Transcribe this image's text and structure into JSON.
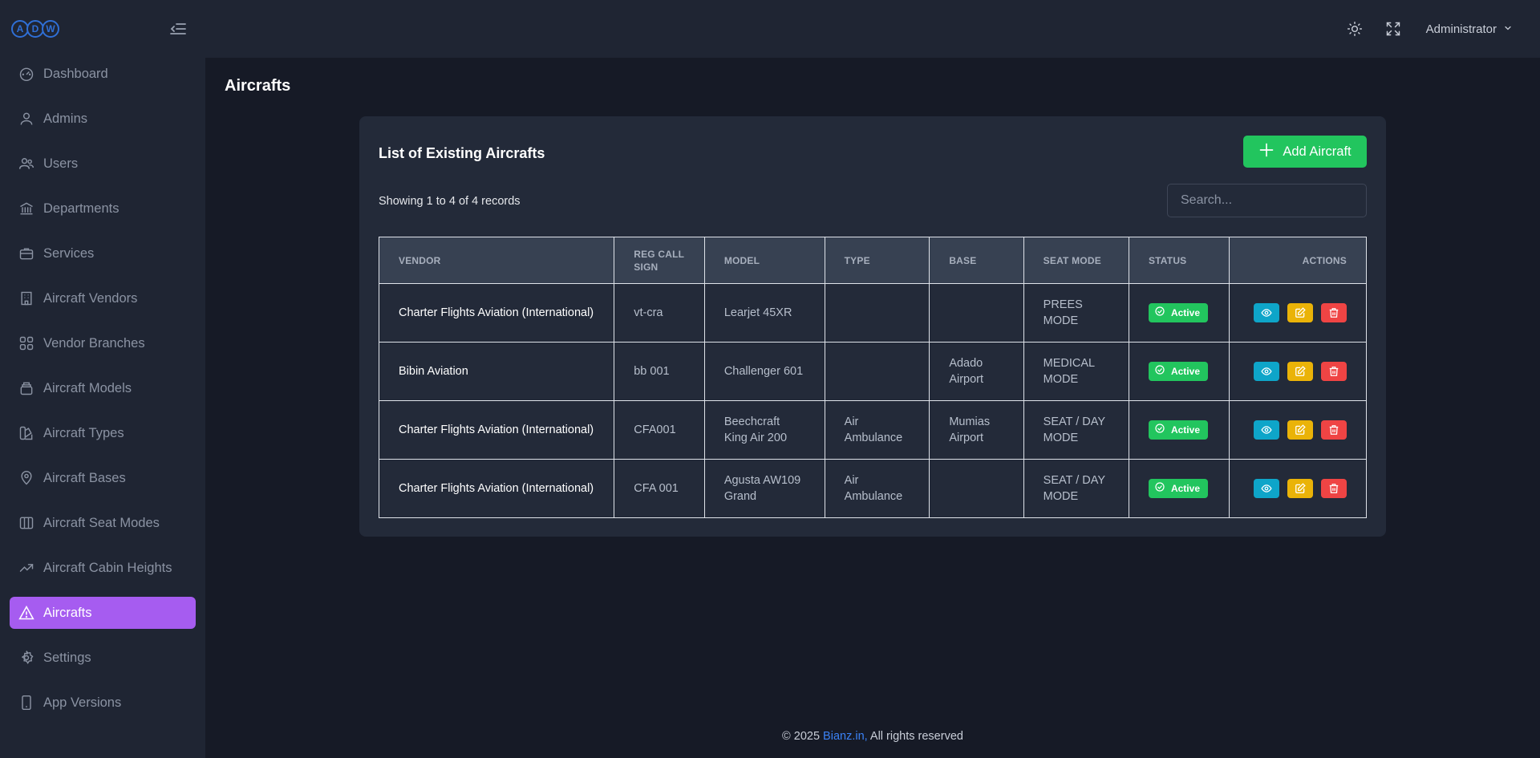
{
  "app": {
    "logo_letters": [
      "A",
      "D",
      "W"
    ]
  },
  "sidebar": {
    "items": [
      {
        "label": "Dashboard",
        "icon": "dashboard-icon"
      },
      {
        "label": "Admins",
        "icon": "user-icon"
      },
      {
        "label": "Users",
        "icon": "users-icon"
      },
      {
        "label": "Departments",
        "icon": "building-columns-icon"
      },
      {
        "label": "Services",
        "icon": "briefcase-icon"
      },
      {
        "label": "Aircraft Vendors",
        "icon": "building-icon"
      },
      {
        "label": "Vendor Branches",
        "icon": "grid-icon"
      },
      {
        "label": "Aircraft Models",
        "icon": "layers-icon"
      },
      {
        "label": "Aircraft Types",
        "icon": "swatch-icon"
      },
      {
        "label": "Aircraft Bases",
        "icon": "map-pin-icon"
      },
      {
        "label": "Aircraft Seat Modes",
        "icon": "columns-icon"
      },
      {
        "label": "Aircraft Cabin Heights",
        "icon": "trending-up-icon"
      },
      {
        "label": "Aircrafts",
        "icon": "warning-triangle-icon",
        "active": true
      },
      {
        "label": "Settings",
        "icon": "gear-icon"
      },
      {
        "label": "App Versions",
        "icon": "smartphone-icon"
      }
    ]
  },
  "topbar": {
    "user_name": "Administrator"
  },
  "page": {
    "title": "Aircrafts"
  },
  "card": {
    "title": "List of Existing Aircrafts",
    "add_button_label": "Add Aircraft",
    "records_text": "Showing 1 to 4 of 4 records",
    "search_placeholder": "Search..."
  },
  "table": {
    "headers": [
      "VENDOR",
      "REG CALL SIGN",
      "MODEL",
      "TYPE",
      "BASE",
      "SEAT MODE",
      "STATUS",
      "ACTIONS"
    ],
    "rows": [
      {
        "vendor": "Charter Flights Aviation (International)",
        "reg": "vt-cra",
        "model": "Learjet 45XR",
        "type": "",
        "base": "",
        "seat_mode": "PREES MODE",
        "status": "Active"
      },
      {
        "vendor": "Bibin Aviation",
        "reg": "bb 001",
        "model": "Challenger 601",
        "type": "",
        "base": "Adado Airport",
        "seat_mode": "MEDICAL MODE",
        "status": "Active"
      },
      {
        "vendor": "Charter Flights Aviation (International)",
        "reg": "CFA001",
        "model": "Beechcraft King Air 200",
        "type": "Air Ambulance",
        "base": "Mumias Airport",
        "seat_mode": "SEAT / DAY MODE",
        "status": "Active"
      },
      {
        "vendor": "Charter Flights Aviation (International)",
        "reg": "CFA 001",
        "model": "Agusta AW109 Grand",
        "type": "Air Ambulance",
        "base": "",
        "seat_mode": "SEAT / DAY MODE",
        "status": "Active"
      }
    ]
  },
  "footer": {
    "prefix": "© 2025 ",
    "link": "Bianz.in,",
    "suffix": " All rights reserved"
  },
  "colors": {
    "accent": "#a65cf0",
    "success": "#22c55e",
    "info": "#0ea5c9",
    "warning": "#eab308",
    "danger": "#ef4444",
    "link": "#3b82f6"
  }
}
